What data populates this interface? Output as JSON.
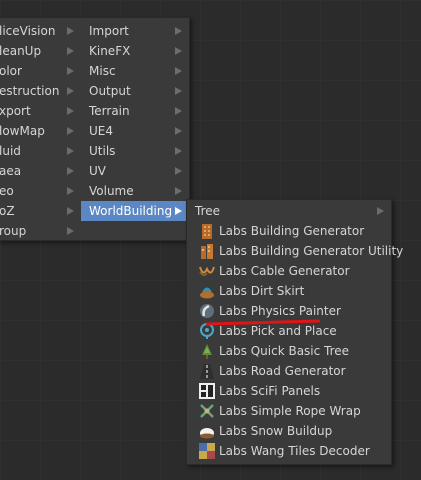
{
  "menu_left": {
    "items": [
      "liceVision",
      "leanUp",
      "olor",
      "estruction",
      "xport",
      "lowMap",
      "luid",
      "aea",
      "eo",
      "oZ",
      "roup"
    ]
  },
  "menu_middle": {
    "items": [
      "Import",
      "KineFX",
      "Misc",
      "Output",
      "Terrain",
      "UE4",
      "Utils",
      "UV",
      "Volume",
      "WorldBuilding"
    ],
    "selected": "WorldBuilding"
  },
  "menu_worldbuilding": {
    "items": [
      {
        "label": "Tree",
        "submenu": true
      },
      {
        "label": "Labs Building Generator",
        "icon": "building-icon"
      },
      {
        "label": "Labs Building Generator Utility",
        "icon": "building-utility-icon"
      },
      {
        "label": "Labs Cable Generator",
        "icon": "cable-icon"
      },
      {
        "label": "Labs Dirt Skirt",
        "icon": "dirt-skirt-icon"
      },
      {
        "label": "Labs Physics Painter",
        "icon": "physics-painter-icon"
      },
      {
        "label": "Labs Pick and Place",
        "icon": "pick-place-icon"
      },
      {
        "label": "Labs Quick Basic Tree",
        "icon": "tree-icon"
      },
      {
        "label": "Labs Road Generator",
        "icon": "road-icon"
      },
      {
        "label": "Labs SciFi Panels",
        "icon": "scifi-panels-icon"
      },
      {
        "label": "Labs Simple Rope Wrap",
        "icon": "rope-wrap-icon"
      },
      {
        "label": "Labs Snow Buildup",
        "icon": "snow-icon"
      },
      {
        "label": "Labs Wang Tiles Decoder",
        "icon": "wang-tiles-icon"
      }
    ]
  },
  "colors": {
    "selection": "#5b87c5",
    "menu_bg": "#3a3a3a",
    "annotation": "#e01414"
  }
}
